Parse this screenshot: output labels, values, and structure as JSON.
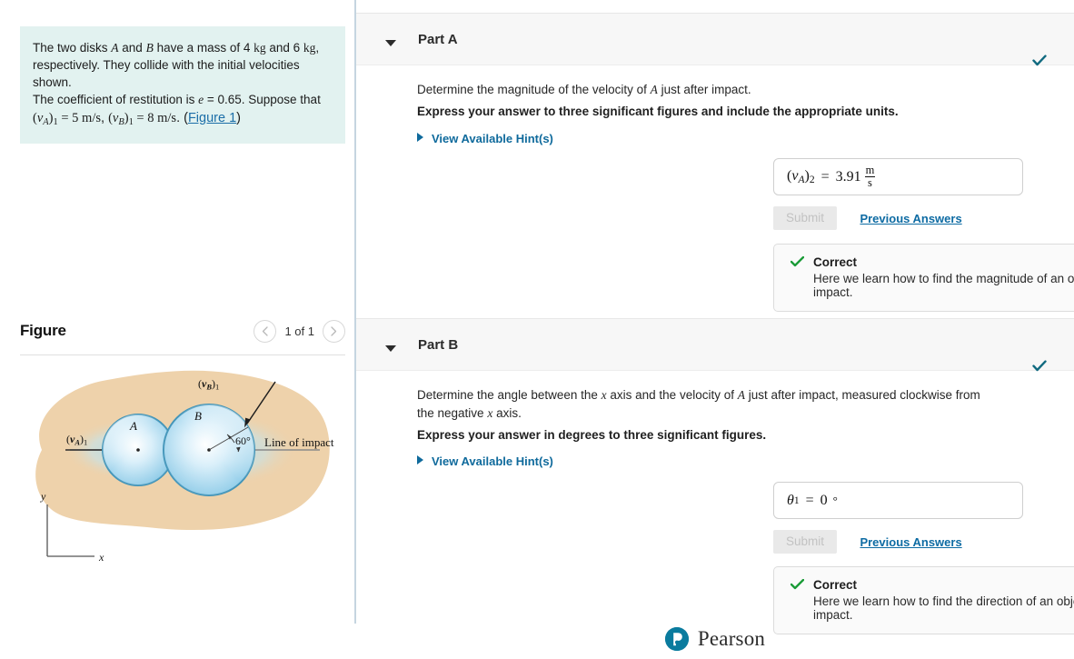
{
  "problem": {
    "line1_a": "The two disks ",
    "var_A": "A",
    "line1_b": " and ",
    "var_B": "B",
    "line1_c": " have a mass of 4 ",
    "unit_kg1": "kg",
    "line1_d": " and 6 ",
    "unit_kg2": "kg",
    "line1_e": ",",
    "line2": "respectively. They collide with the initial velocities shown.",
    "line3_a": "The coefficient of restitution is ",
    "var_e": "e",
    "line3_b": " = 0.65. Suppose that",
    "va_label": "v",
    "va_sub": "A",
    "va_index": "1",
    "va_eq": " = 5 ",
    "va_unit": "m/s",
    "comma": ", ",
    "vb_label": "v",
    "vb_sub": "B",
    "vb_index": "1",
    "vb_eq": " = 8 ",
    "vb_unit": "m/s",
    "period": ". (",
    "figure_link": "Figure 1",
    "close_paren": ")"
  },
  "figure": {
    "title": "Figure",
    "prev_icon": "chevron-left",
    "next_icon": "chevron-right",
    "page_label": "1 of 1",
    "labels": {
      "disk_a": "A",
      "disk_b": "B",
      "va": "v",
      "va_sub": "A",
      "va_idx": "1",
      "vb": "v",
      "vb_sub": "B",
      "vb_idx": "1",
      "angle": "60°",
      "line_of_impact": "Line of impact",
      "axis_x": "x",
      "axis_y": "y"
    },
    "colors": {
      "background_blob": "#eed2ab",
      "disk_fill": "#a8d8ef",
      "disk_stroke": "#3f93b8",
      "glow": "#bfe3f2"
    }
  },
  "parts": [
    {
      "id": "part-a",
      "title": "Part A",
      "status_icon": "check",
      "status_color": "#116a80",
      "question": "Determine the magnitude of the velocity of A just after impact.",
      "question_pre": "Determine the magnitude of the velocity of ",
      "question_var": "A",
      "question_post": " just after impact.",
      "instruction": "Express your answer to three significant figures and include the appropriate units.",
      "hints_label": "View Available Hint(s)",
      "answer": {
        "symbol": "v",
        "symbol_sub": "A",
        "symbol_index": "2",
        "equals": "=",
        "value": "3.91",
        "unit_num": "m",
        "unit_den": "s"
      },
      "submit_label": "Submit",
      "previous_answers_label": "Previous Answers",
      "feedback": {
        "title": "Correct",
        "body": "Here we learn how to find the magnitude of an object's velocity after a non-elastic oblique impact.",
        "icon": "check",
        "color": "#1a9b37"
      }
    },
    {
      "id": "part-b",
      "title": "Part B",
      "status_icon": "check",
      "status_color": "#116a80",
      "question_pre": "Determine the angle between the ",
      "question_var1": "x",
      "question_mid": " axis and the velocity of ",
      "question_var2": "A",
      "question_mid2": " just after impact, measured clockwise from the negative ",
      "question_var3": "x",
      "question_post": " axis.",
      "instruction": "Express your answer in degrees to three significant figures.",
      "hints_label": "View Available Hint(s)",
      "answer": {
        "symbol": "θ",
        "symbol_index": "1",
        "equals": "=",
        "value": "0",
        "unit": "°"
      },
      "submit_label": "Submit",
      "previous_answers_label": "Previous Answers",
      "feedback": {
        "title": "Correct",
        "body": "Here we learn how to find the direction of an object's velocity after a non-elastic oblique impact.",
        "icon": "check",
        "color": "#1a9b37"
      }
    }
  ],
  "footer": {
    "brand": "Pearson",
    "logo_icon": "pearson-p-icon",
    "logo_color": "#0a7b9e"
  }
}
